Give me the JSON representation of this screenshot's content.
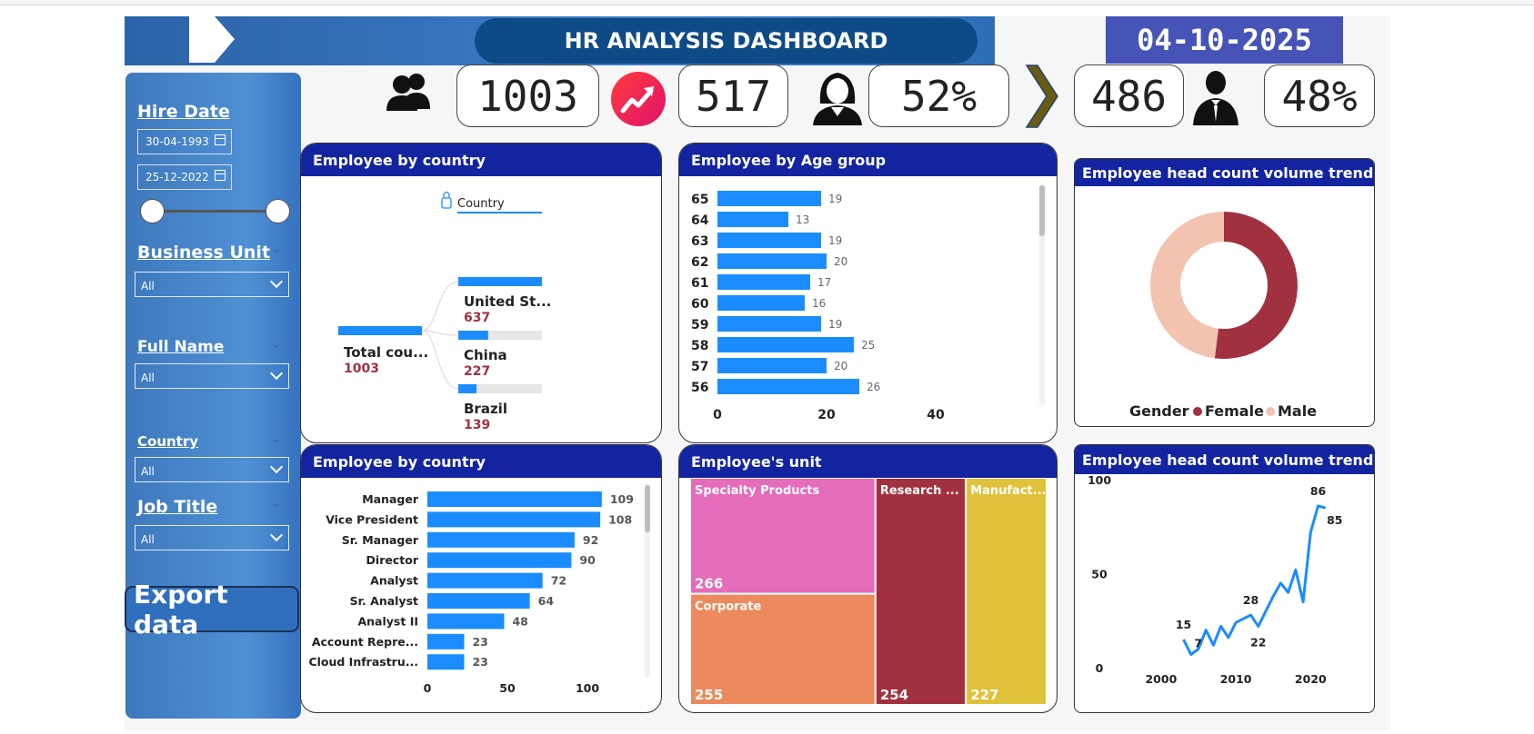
{
  "header": {
    "title": "HR ANALYSIS DASHBOARD",
    "date": "04-10-2025"
  },
  "kpis": {
    "total": "1003",
    "growth": "517",
    "female_pct": "52%",
    "male_count": "486",
    "male_pct": "48%"
  },
  "colors": {
    "accent_blue": "#1a8cff",
    "header_navy": "#1324a0",
    "female": "#a2313f",
    "male": "#f2c4b0"
  },
  "filters": {
    "hire_date_label": "Hire Date",
    "hire_date_from": "30-04-1993",
    "hire_date_to": "25-12-2022",
    "business_unit_label": "Business Unit",
    "business_unit_value": "All",
    "full_name_label": "Full Name",
    "full_name_value": "All",
    "country_label": "Country",
    "country_value": "All",
    "job_title_label": "Job Title",
    "job_title_value": "All",
    "export_label": "Export data"
  },
  "cards": {
    "country_tree": "Employee by country",
    "age_group": "Employee by Age group",
    "gender_donut": "Employee head count volume trend",
    "job_title": "Employee by country",
    "unit_treemap": "Employee's unit",
    "trend_line": "Employee head count volume trend"
  },
  "chart_data": [
    {
      "type": "bar",
      "chart": "decomposition-tree",
      "header_label": "Country",
      "root": {
        "label": "Total cou...",
        "value": 1003
      },
      "categories": [
        "United St...",
        "China",
        "Brazil"
      ],
      "values": [
        637,
        227,
        139
      ]
    },
    {
      "type": "bar",
      "orientation": "horizontal",
      "categories": [
        "65",
        "64",
        "63",
        "62",
        "61",
        "60",
        "59",
        "58",
        "57",
        "56"
      ],
      "values": [
        19,
        13,
        19,
        20,
        17,
        16,
        19,
        25,
        20,
        26
      ],
      "xticks": [
        "0",
        "20",
        "40"
      ],
      "xlim": [
        0,
        50
      ]
    },
    {
      "type": "pie",
      "donut": true,
      "legend_title": "Gender",
      "legend_position": "bottom",
      "labels": [
        "Female",
        "Male"
      ],
      "values": [
        52,
        48
      ]
    },
    {
      "type": "bar",
      "orientation": "horizontal",
      "categories": [
        "Manager",
        "Vice President",
        "Sr. Manager",
        "Director",
        "Analyst",
        "Sr. Analyst",
        "Analyst II",
        "Account Repre...",
        "Cloud Infrastru..."
      ],
      "values": [
        109,
        108,
        92,
        90,
        72,
        64,
        48,
        23,
        23
      ],
      "xticks": [
        "0",
        "50",
        "100"
      ],
      "xlim": [
        0,
        120
      ]
    },
    {
      "type": "heatmap",
      "chart": "treemap",
      "labels": [
        "Specialty Products",
        "Corporate",
        "Research ...",
        "Manufact..."
      ],
      "values": [
        266,
        255,
        254,
        227
      ],
      "colors": [
        "#e56bbb",
        "#ec8a5e",
        "#a2313f",
        "#dfc23a"
      ]
    },
    {
      "type": "line",
      "x": [
        2003,
        2004,
        2005,
        2006,
        2007,
        2008,
        2009,
        2010,
        2011,
        2012,
        2013,
        2014,
        2015,
        2016,
        2017,
        2018,
        2019,
        2020,
        2021,
        2022
      ],
      "y": [
        15,
        7,
        10,
        20,
        12,
        22,
        16,
        24,
        26,
        28,
        22,
        30,
        38,
        45,
        40,
        52,
        35,
        72,
        86,
        85
      ],
      "xticks": [
        "2000",
        "2010",
        "2020"
      ],
      "yticks": [
        "0",
        "50",
        "100"
      ],
      "labeled_points": [
        "15",
        "7",
        "28",
        "22",
        "86",
        "85"
      ],
      "xlim": [
        1996,
        2023
      ],
      "ylim": [
        0,
        100
      ]
    }
  ]
}
